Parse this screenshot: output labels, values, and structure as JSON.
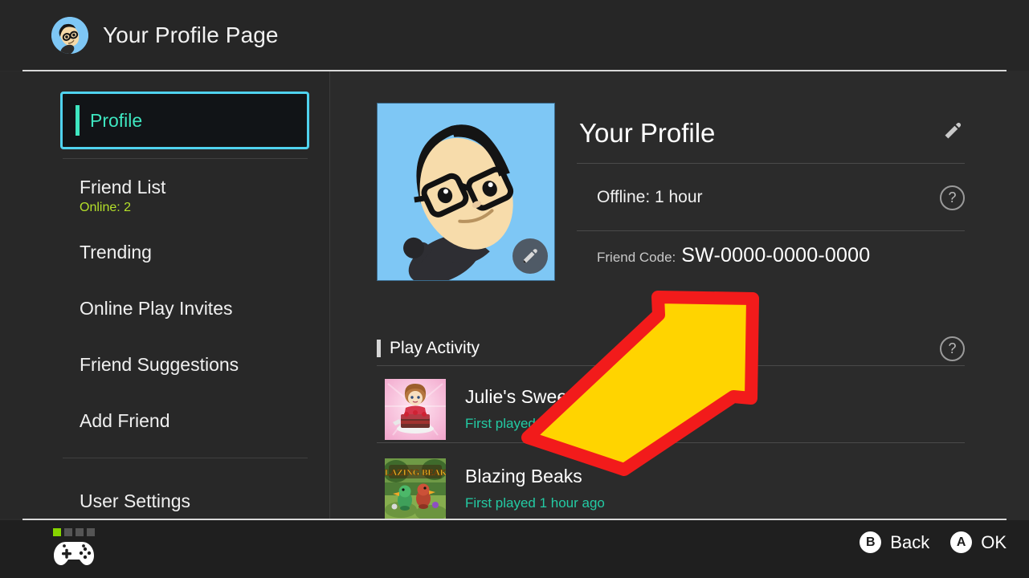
{
  "header": {
    "title": "Your Profile Page",
    "avatar_icon": "mii-avatar-icon"
  },
  "sidebar": {
    "selected": {
      "label": "Profile"
    },
    "items": [
      {
        "label": "Friend List",
        "sub": "Online: 2"
      },
      {
        "label": "Trending",
        "sub": ""
      },
      {
        "label": "Online Play Invites",
        "sub": ""
      },
      {
        "label": "Friend Suggestions",
        "sub": ""
      },
      {
        "label": "Add Friend",
        "sub": ""
      },
      {
        "label": "User Settings",
        "sub": ""
      }
    ]
  },
  "main": {
    "mii": {
      "edit_badge_icon": "pencil-icon"
    },
    "profile": {
      "title": "Your Profile",
      "edit_icon": "pencil-icon",
      "status": "Offline: 1 hour",
      "status_help_icon": "question-mark-icon",
      "friend_code_label": "Friend Code:",
      "friend_code_value": "SW-0000-0000-0000"
    },
    "play_activity": {
      "title": "Play Activity",
      "help_icon": "question-mark-icon",
      "games": [
        {
          "name": "Julie's Sweets",
          "sub": "First played 1 hour ago",
          "thumb": "juliues-sweets-thumbnail"
        },
        {
          "name": "Blazing Beaks",
          "sub": "First played 1 hour ago",
          "thumb": "blazing-beaks-thumbnail"
        }
      ]
    }
  },
  "footer": {
    "controller_icon": "gamepad-icon",
    "player_slots": [
      true,
      false,
      false,
      false
    ],
    "hints": [
      {
        "button": "B",
        "label": "Back"
      },
      {
        "button": "A",
        "label": "OK"
      }
    ]
  },
  "annotation": {
    "arrow_fill": "#FFD400",
    "arrow_stroke": "#F21B1B"
  },
  "colors": {
    "accent_cyan": "#4fd2ef",
    "accent_teal": "#3ee6c0",
    "online_green": "#b4e02a",
    "activity_green": "#23cba4",
    "background": "#2b2b2b"
  }
}
